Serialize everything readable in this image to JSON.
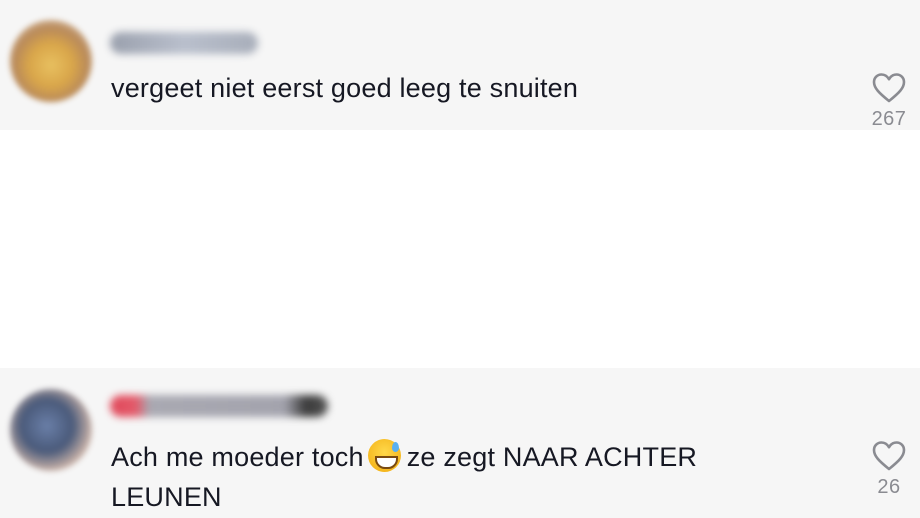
{
  "comments": [
    {
      "text": "vergeet niet eerst goed leeg te snuiten",
      "likes": "267",
      "avatar_icon": "user-avatar-blurred",
      "username_blurred": true
    },
    {
      "text_before_emoji": "Ach me moeder toch",
      "emoji": "grinning-face-with-sweat",
      "text_after_emoji": "ze zegt NAAR ACHTER LEUNEN",
      "likes": "26",
      "avatar_icon": "user-avatar-blurred",
      "username_blurred": true
    }
  ],
  "colors": {
    "comment_bg": "#f6f6f6",
    "text": "#161823",
    "like_count": "#8a8b91"
  }
}
